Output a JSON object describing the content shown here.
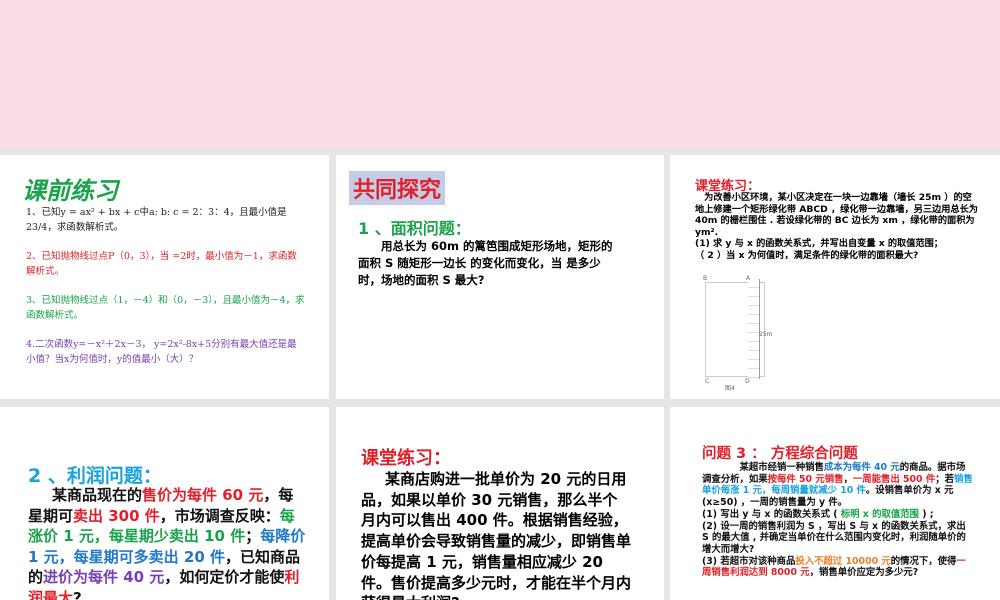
{
  "p1": {
    "title": "课前练习",
    "paras": [
      {
        "color": "#222222",
        "text": "1、已知y = ax² + bx + c中a: b: c = 2：3：4，且最小值是23/4，求函数解析式。"
      },
      {
        "color": "#e0202a",
        "text": "2、已知抛物线过点P（0，3），当 =2时，最小值为－1，求函数解析式。"
      },
      {
        "color": "#1aa34a",
        "text": "3、已知抛物线过点（1，－4）和（0，－3），且最小值为－4，求函数解析式。"
      },
      {
        "color": "#7a3fb0",
        "text": "4.二次函数y=－x²＋2x－3， y=2x²-8x+5分别有最大值还是最小值？当x为何值时，y的值最小（大）？"
      }
    ]
  },
  "p2": {
    "title": "共同探究",
    "subtitle": "1 、面积问题：",
    "body": "用总长为 60m 的篱笆围成矩形场地，矩形的面积 S 随矩形一边长 的变化而变化，当 是多少时，场地的面积 S  最大?"
  },
  "p3": {
    "title": "课堂练习：",
    "body": "　为改善小区环境，某小区决定在一块一边靠墙（墙长 25m ）的空地上修建一个矩形绿化带 ABCD ，绿化带一边靠墙，另三边用总长为 40m 的栅栏围住 . 若设绿化带的 BC 边长为 xm ，绿化带的面积为 ym².",
    "q1": "(1) 求 y 与 x 的函数关系式，并写出自变量 x 的取值范围；",
    "q2": "（ 2 ）当 x 为何值时，满足条件的绿化带的面积最大?",
    "figure": {
      "b": "B",
      "a": "A",
      "c": "C",
      "d": "D",
      "wall": "25m",
      "caption": "图4"
    }
  },
  "p4": {
    "subtitle": "2 、利润问题：",
    "segments": [
      {
        "c": "#111111",
        "t": "某商品现在的"
      },
      {
        "c": "#e0202a",
        "t": "售价为每件 60 元"
      },
      {
        "c": "#111111",
        "t": "，每星期可"
      },
      {
        "c": "#e0202a",
        "t": "卖出 300 件"
      },
      {
        "c": "#111111",
        "t": "，市场调查反映："
      },
      {
        "c": "#1aa34a",
        "t": "每涨价 1 元，每星期少卖出 10 件"
      },
      {
        "c": "#111111",
        "t": "；"
      },
      {
        "c": "#1f78c8",
        "t": "每降价 1 元，每星期可多卖出 20 件"
      },
      {
        "c": "#111111",
        "t": "，已知商品的"
      },
      {
        "c": "#7a3fb0",
        "t": "进价为每件 40 元"
      },
      {
        "c": "#111111",
        "t": "，如何定价才能使"
      },
      {
        "c": "#e0202a",
        "t": "利润最大"
      },
      {
        "c": "#111111",
        "t": "?"
      }
    ]
  },
  "p5": {
    "title": "课堂练习：",
    "body": "某商店购进一批单价为 20 元的日用品，如果以单价 30 元销售，那么半个月内可以售出 400 件。根据销售经验，提高单价会导致销售量的减少，即销售单价每提高 1 元，销售量相应减少 20 件。售价提高多少元时，才能在半个月内获得最大利润?"
  },
  "p6": {
    "title": "问题 3 ：  方程综合问题",
    "segments": [
      {
        "c": "#111111",
        "t": "　　　　某超市经销一种销售"
      },
      {
        "c": "#1f78c8",
        "t": "成本为每件 40 元"
      },
      {
        "c": "#111111",
        "t": "的商品。据市场调查分析，如果"
      },
      {
        "c": "#e0202a",
        "t": "按每件 50 元销售"
      },
      {
        "c": "#111111",
        "t": "，"
      },
      {
        "c": "#e0202a",
        "t": "一周能售出 500 件"
      },
      {
        "c": "#111111",
        "t": "；若"
      },
      {
        "c": "#1aa3dd",
        "t": "销售单价每涨 1 元，每周销量就减少 10 件"
      },
      {
        "c": "#111111",
        "t": "。设销售单价为 x 元 (x≥50) ，一周的销售量为 y 件。\n(1) 写出 y 与 x 的函数关系式 ( "
      },
      {
        "c": "#1aa34a",
        "t": "标明 x 的取值范围"
      },
      {
        "c": "#111111",
        "t": " ) ;\n(2) 设一周的销售利润为 S ，写出 S 与 x 的函数关系式，求出 S 的最大值 , 并确定当单价在什么范围内变化时，利润随单价的增大而增大?\n(3) 若超市对该种商品"
      },
      {
        "c": "#e8802a",
        "t": "投入不超过 10000 元"
      },
      {
        "c": "#111111",
        "t": "的情况下，使得"
      },
      {
        "c": "#e0202a",
        "t": "一周销售利润达到 8000 元"
      },
      {
        "c": "#111111",
        "t": "，销售单价应定为多少元?"
      }
    ]
  }
}
